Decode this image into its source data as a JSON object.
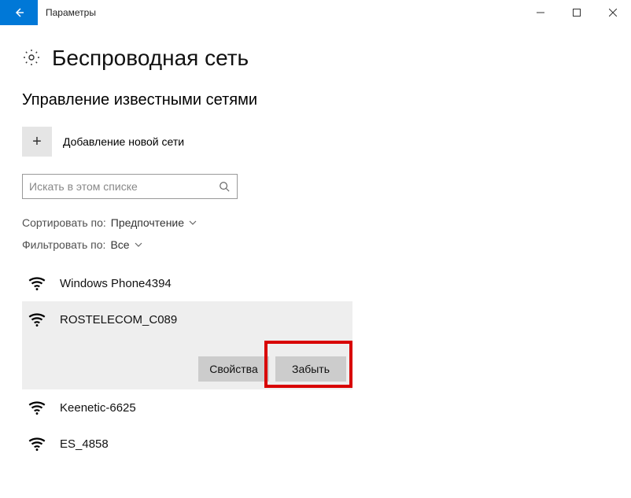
{
  "window": {
    "title": "Параметры"
  },
  "page": {
    "title": "Беспроводная сеть",
    "section_title": "Управление известными сетями",
    "add_network_label": "Добавление новой сети"
  },
  "search": {
    "placeholder": "Искать в этом списке"
  },
  "filters": {
    "sort_label": "Сортировать по:",
    "sort_value": "Предпочтение",
    "filter_label": "Фильтровать по:",
    "filter_value": "Все"
  },
  "networks": {
    "items": [
      {
        "name": "Windows Phone4394",
        "selected": false
      },
      {
        "name": "ROSTELECOM_C089",
        "selected": true
      },
      {
        "name": "Keenetic-6625",
        "selected": false
      },
      {
        "name": "ES_4858",
        "selected": false
      }
    ]
  },
  "actions": {
    "properties": "Свойства",
    "forget": "Забыть"
  }
}
